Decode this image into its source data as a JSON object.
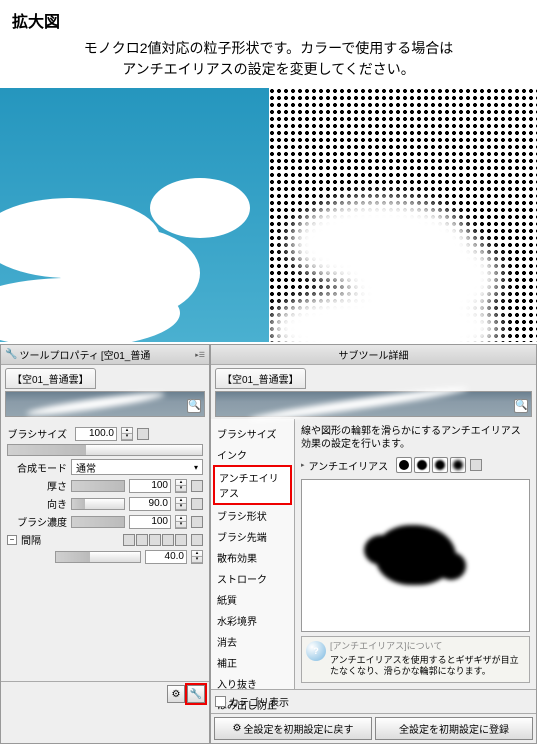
{
  "header": {
    "title": "拡大図",
    "desc_line1": "モノクロ2値対応の粒子形状です。カラーで使用する場合は",
    "desc_line2": "アンチエイリアスの設定を変更してください。"
  },
  "left_panel": {
    "title_prefix": "ツールプロパティ",
    "title_brush": "[空01_普通",
    "tab": "【空01_普通雲】",
    "props": {
      "brush_size_label": "ブラシサイズ",
      "brush_size_value": "100.0",
      "blend_label": "合成モード",
      "blend_value": "通常",
      "thickness_label": "厚さ",
      "thickness_value": "100",
      "direction_label": "向き",
      "direction_value": "90.0",
      "density_label": "ブラシ濃度",
      "density_value": "100",
      "spacing_label": "間隔",
      "spacing_value": "40.0"
    }
  },
  "right_panel": {
    "title": "サブツール詳細",
    "tab": "【空01_普通雲】",
    "desc": "線や図形の輪郭を滑らかにするアンチエイリアス効果の設定を行います。",
    "categories": [
      "ブラシサイズ",
      "インク",
      "アンチエイリアス",
      "ブラシ形状",
      "ブラシ先端",
      "散布効果",
      "ストローク",
      "紙質",
      "水彩境界",
      "消去",
      "補正",
      "入り抜き",
      "はみ出し防止"
    ],
    "selected_cat_index": 2,
    "aa_label": "アンチエイリアス",
    "info": {
      "title": "[アンチエイリアス]について",
      "text": "アンチエイリアスを使用するとギザギザが目立たなくなり、滑らかな輪郭になります。"
    },
    "cat_show": "カテゴリ表示",
    "footer_reset": "全設定を初期設定に戻す",
    "footer_save": "全設定を初期設定に登録"
  }
}
